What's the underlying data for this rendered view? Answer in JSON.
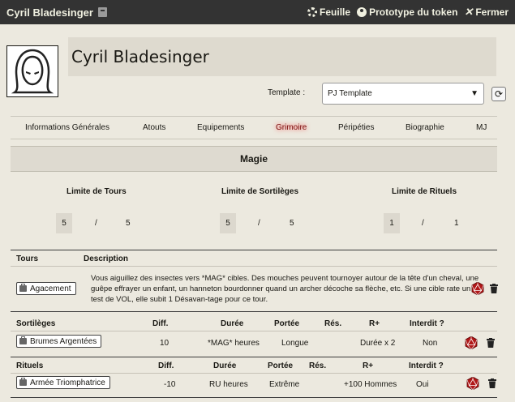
{
  "window": {
    "title": "Cyril Bladesinger",
    "actions": [
      {
        "icon": "gear-icon",
        "label": "Feuille"
      },
      {
        "icon": "user-circle-icon",
        "label": "Prototype du token"
      },
      {
        "icon": "close-icon",
        "label": "Fermer"
      }
    ]
  },
  "character": {
    "name": "Cyril Bladesinger"
  },
  "template": {
    "label": "Template :",
    "value": "PJ Template"
  },
  "tabs": [
    {
      "label": "Informations Générales"
    },
    {
      "label": "Atouts"
    },
    {
      "label": "Equipements"
    },
    {
      "label": "Grimoire",
      "active": true
    },
    {
      "label": "Péripéties"
    },
    {
      "label": "Biographie"
    },
    {
      "label": "MJ"
    }
  ],
  "magie": {
    "title": "Magie",
    "limits": [
      {
        "label": "Limite de Tours",
        "current": "5",
        "sep": "/",
        "max": "5"
      },
      {
        "label": "Limite de Sortilèges",
        "current": "5",
        "sep": "/",
        "max": "5"
      },
      {
        "label": "Limite de Rituels",
        "current": "1",
        "sep": "/",
        "max": "1"
      }
    ]
  },
  "tours": {
    "headers": {
      "name": "Tours",
      "description": "Description"
    },
    "items": [
      {
        "name": "Agacement",
        "description": "Vous aiguillez des insectes vers *MAG* cibles. Des mouches peuvent tournoyer autour de la tête d'un cheval, une guêpe effrayer un enfant, un hanneton bourdonner quand un archer décoche sa flèche, etc. Si une cible rate un test de VOL, elle subit 1 Désavan-tage pour ce tour."
      }
    ]
  },
  "sortileges": {
    "headers": {
      "name": "Sortilèges",
      "diff": "Diff.",
      "duree": "Durée",
      "portee": "Portée",
      "res": "Rés.",
      "rplus": "R+",
      "interdit": "Interdit ?"
    },
    "items": [
      {
        "name": "Brumes Argentées",
        "diff": "10",
        "duree": "*MAG* heures",
        "portee": "Longue",
        "res": "",
        "rplus": "Durée x 2",
        "interdit": "Non"
      }
    ]
  },
  "rituels": {
    "headers": {
      "name": "Rituels",
      "diff": "Diff.",
      "duree": "Durée",
      "portee": "Portée",
      "res": "Rés.",
      "rplus": "R+",
      "interdit": "Interdit ?"
    },
    "items": [
      {
        "name": "Armée Triomphatrice",
        "diff": "-10",
        "duree": "RU heures",
        "portee": "Extrême",
        "res": "",
        "rplus": "+100 Hommes",
        "interdit": "Oui"
      }
    ]
  },
  "colors": {
    "titlebar": "#333333",
    "active_tab": "#7a0d0d",
    "dice": "#b01818"
  }
}
